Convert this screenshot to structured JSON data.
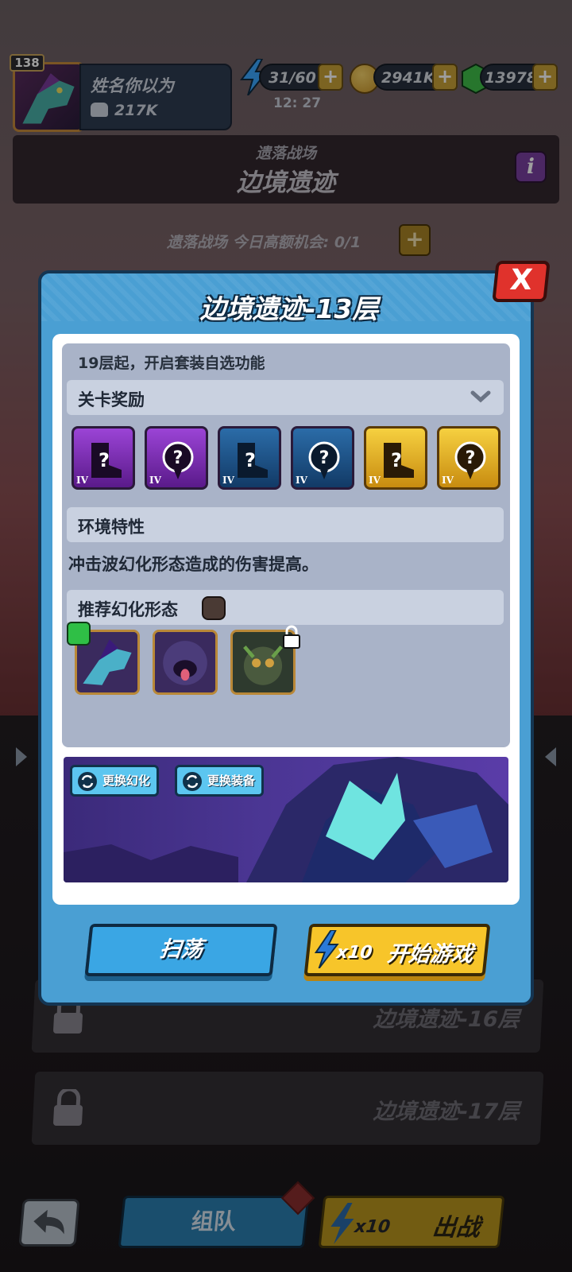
{
  "player": {
    "level": "138",
    "name": "姓名你以为",
    "power": "217K"
  },
  "resources": {
    "energy": "31/60",
    "energy_timer": "12: 27",
    "coins": "2941K",
    "gems": "13978"
  },
  "banner": {
    "subtitle": "遗落战场",
    "title": "边境遗迹"
  },
  "chance_text": "遗落战场 今日高额机会: 0/1",
  "background_levels": [
    "边境遗迹-16层",
    "边境遗迹-17层"
  ],
  "modal": {
    "title": "边境遗迹-13层",
    "close_label": "X",
    "unlock_hint": "19层起，开启套装自选功能",
    "rewards_header": "关卡奖励",
    "rewards": [
      {
        "tier": "IV",
        "type": "boots",
        "rarity": "purple"
      },
      {
        "tier": "IV",
        "type": "amulet",
        "rarity": "purple"
      },
      {
        "tier": "IV",
        "type": "boots",
        "rarity": "blue"
      },
      {
        "tier": "IV",
        "type": "amulet",
        "rarity": "blue"
      },
      {
        "tier": "IV",
        "type": "boots",
        "rarity": "gold"
      },
      {
        "tier": "IV",
        "type": "amulet",
        "rarity": "gold"
      }
    ],
    "env_header": "环境特性",
    "env_text": "冲击波幻化形态造成的伤害提高。",
    "recommend_header": "推荐幻化形态",
    "change_form_label": "更换幻化",
    "change_gear_label": "更换装备",
    "sweep_label": "扫荡",
    "start_cost": "x10",
    "start_label": "开始游戏"
  },
  "bottom_bar": {
    "team_label": "组队",
    "battle_cost": "x10",
    "battle_label": "出战"
  },
  "colors": {
    "modal_blue": "#4a9fd3",
    "start_yellow": "#f7c52a",
    "close_red": "#e0322c"
  }
}
